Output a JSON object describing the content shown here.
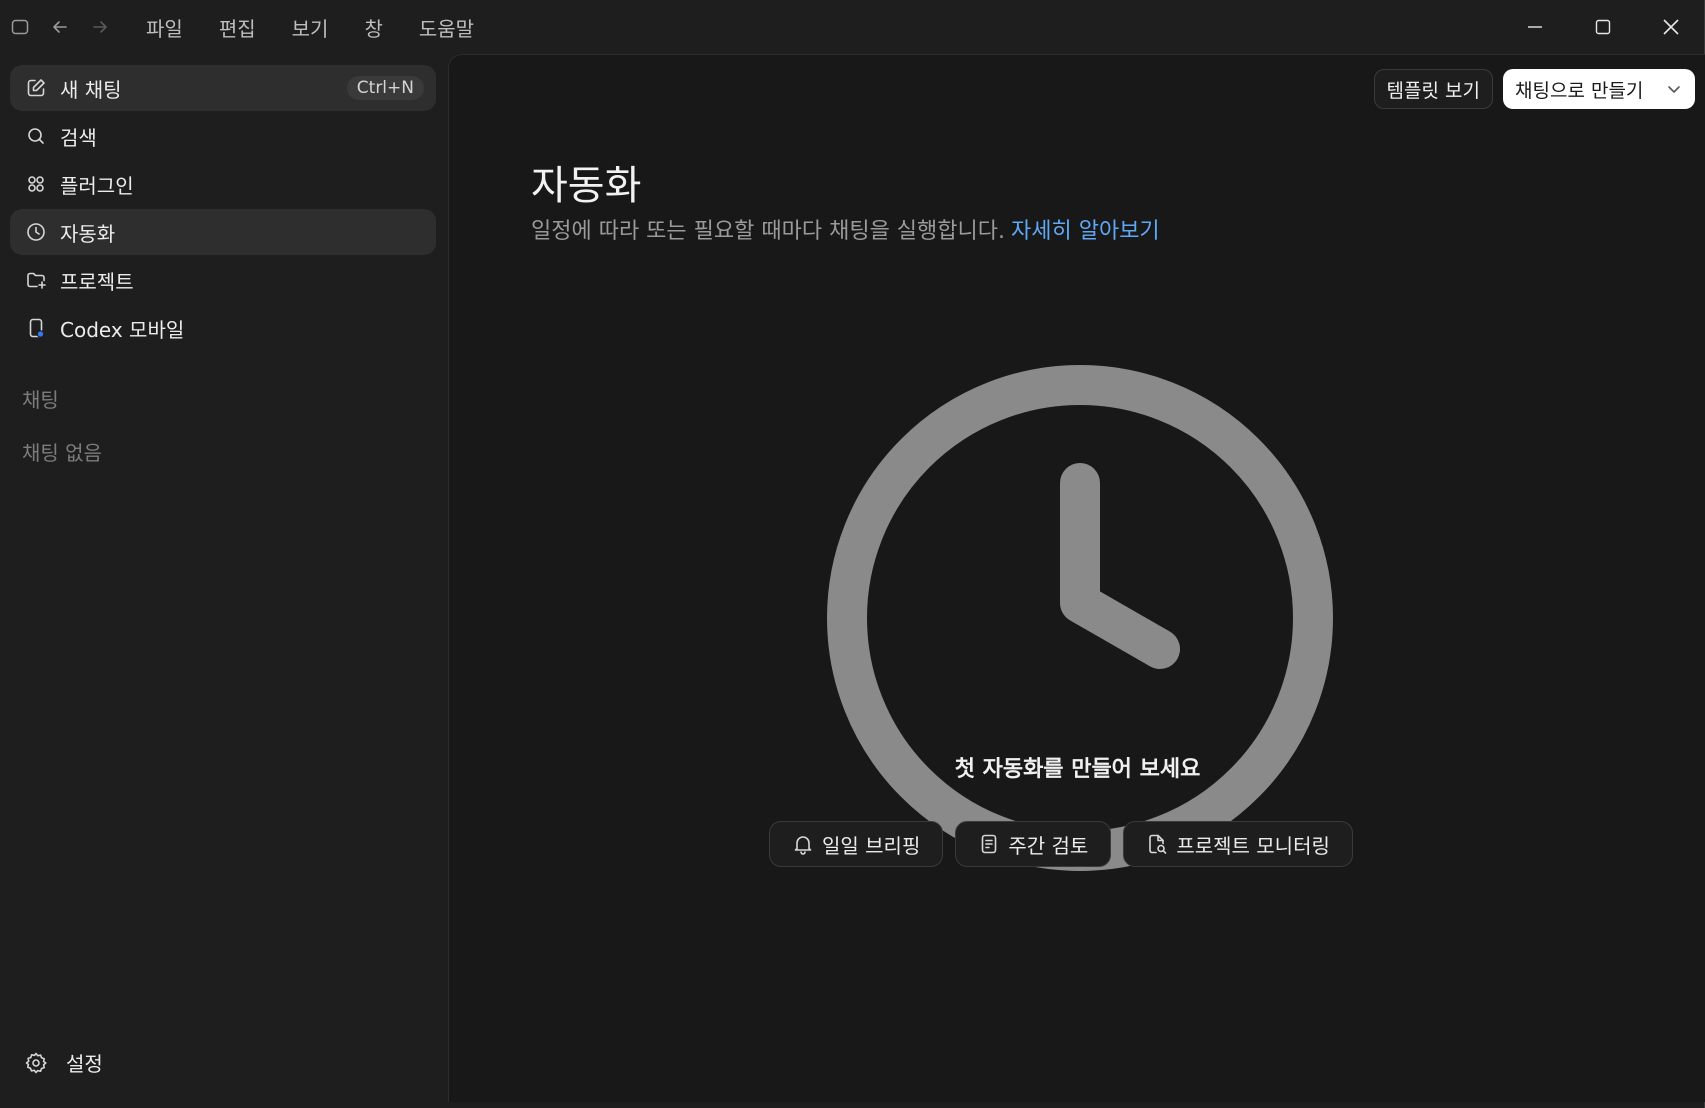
{
  "menu": [
    "파일",
    "편집",
    "보기",
    "창",
    "도움말"
  ],
  "sidebar": {
    "items": [
      {
        "label": "새 채팅",
        "icon": "edit-icon",
        "shortcut": "Ctrl+N"
      },
      {
        "label": "검색",
        "icon": "search-icon"
      },
      {
        "label": "플러그인",
        "icon": "grid-icon"
      },
      {
        "label": "자동화",
        "icon": "clock-icon"
      },
      {
        "label": "프로젝트",
        "icon": "folder-add-icon"
      },
      {
        "label": "Codex 모바일",
        "icon": "mobile-icon"
      }
    ],
    "section_title": "채팅",
    "empty_text": "채팅 없음",
    "settings_label": "설정"
  },
  "header": {
    "template_button": "템플릿 보기",
    "create_button": "채팅으로 만들기"
  },
  "main": {
    "title": "자동화",
    "subtitle": "일정에 따라 또는 필요할 때마다 채팅을 실행합니다.",
    "learn_more": "자세히 알아보기",
    "empty_title": "첫 자동화를 만들어 보세요",
    "chips": [
      {
        "label": "일일 브리핑",
        "icon": "bell-icon"
      },
      {
        "label": "주간 검토",
        "icon": "document-icon"
      },
      {
        "label": "프로젝트 모니터링",
        "icon": "file-search-icon"
      }
    ]
  },
  "colors": {
    "accent_link": "#5fa8f5",
    "background": "#181818",
    "sidebar": "#1e1e1e",
    "clock": "#8a8a8a"
  }
}
